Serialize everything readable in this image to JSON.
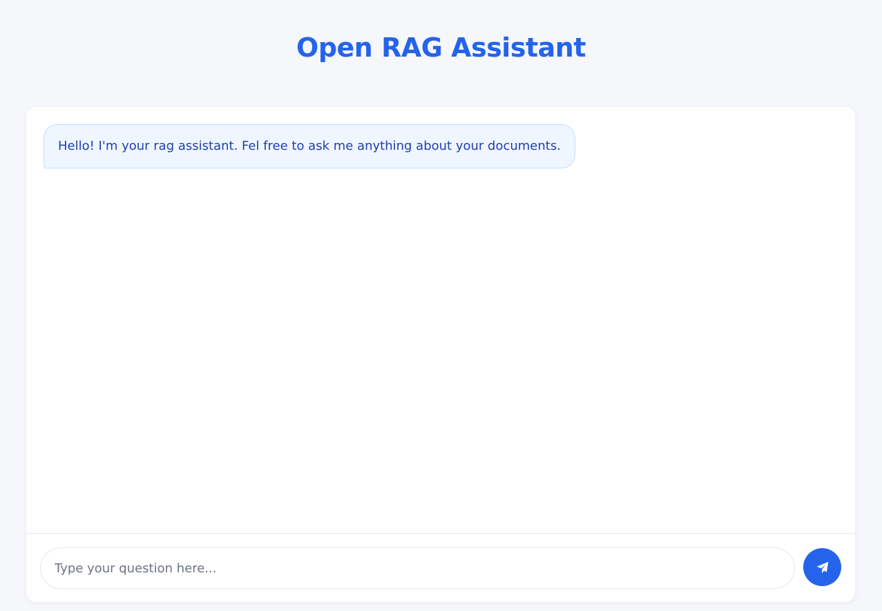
{
  "header": {
    "title": "Open RAG Assistant"
  },
  "chat": {
    "messages": [
      {
        "role": "assistant",
        "text": "Hello! I'm your rag assistant. Fel free to ask me anything about your documents."
      }
    ]
  },
  "composer": {
    "placeholder": "Type your question here...",
    "value": "",
    "send_icon": "paper-plane-icon"
  },
  "colors": {
    "accent": "#2563eb",
    "background": "#f5f7fa",
    "bubble_bg": "#eff6ff",
    "bubble_border": "#bfdbfe",
    "bubble_text": "#1e40af"
  }
}
